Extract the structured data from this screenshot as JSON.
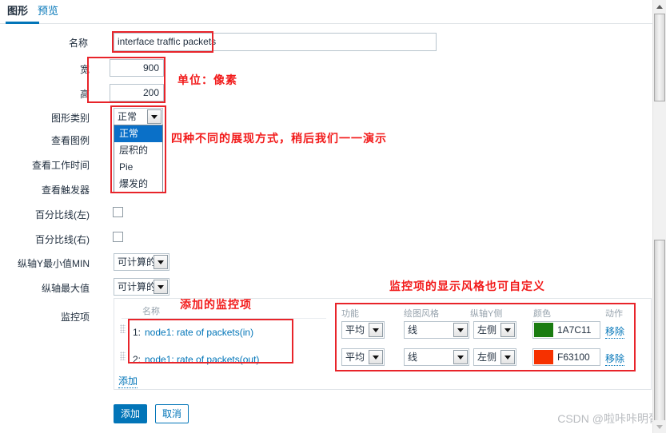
{
  "tabs": [
    {
      "label": "图形",
      "active": true
    },
    {
      "label": "预览",
      "active": false
    }
  ],
  "form": {
    "name_label": "名称",
    "name_value": "interface traffic packets",
    "width_label": "宽",
    "width_value": "900",
    "height_label": "高",
    "height_value": "200",
    "unit_note": "单位：像素",
    "graph_type_label": "图形类别",
    "graph_type_value": "正常",
    "graph_type_options": [
      "正常",
      "层积的",
      "Pie",
      "爆发的"
    ],
    "graph_type_selected_index": 0,
    "graph_type_note": "四种不同的展现方式，稍后我们一一演示",
    "show_legend_label": "查看图例",
    "show_worktime_label": "查看工作时间",
    "show_trigger_label": "查看触发器",
    "percentile_left_label": "百分比线(左)",
    "percentile_left_checked": false,
    "percentile_right_label": "百分比线(右)",
    "percentile_right_checked": false,
    "ymin_label": "纵轴Y最小值MIN",
    "ymin_value": "可计算的",
    "ymax_label": "纵轴最大值",
    "ymax_value": "可计算的",
    "items_label": "监控项"
  },
  "items_panel": {
    "name_column_header": "名称",
    "items_note": "添加的监控项",
    "style_note": "监控项的显示风格也可自定义",
    "columns": {
      "function": "功能",
      "draw_style": "绘图风格",
      "yaxis_side": "纵轴Y侧",
      "color": "颜色",
      "action": "动作"
    },
    "add_link": "添加",
    "rows": [
      {
        "index": "1:",
        "name": "node1: rate of packets(in)",
        "function": "平均",
        "draw_style": "线",
        "yaxis_side": "左侧",
        "color_hex": "1A7C11",
        "color_css": "#1A7C11",
        "remove": "移除"
      },
      {
        "index": "2:",
        "name": "node1: rate of packets(out)",
        "function": "平均",
        "draw_style": "线",
        "yaxis_side": "左侧",
        "color_hex": "F63100",
        "color_css": "#F63100",
        "remove": "移除"
      }
    ]
  },
  "footer": {
    "submit_label": "添加",
    "cancel_label": "取消"
  },
  "watermark": "CSDN @啦咔咔明胥",
  "colors": {
    "accent": "#0275b8",
    "annotation_red": "#f21b1b",
    "box_red": "#e8242a"
  }
}
